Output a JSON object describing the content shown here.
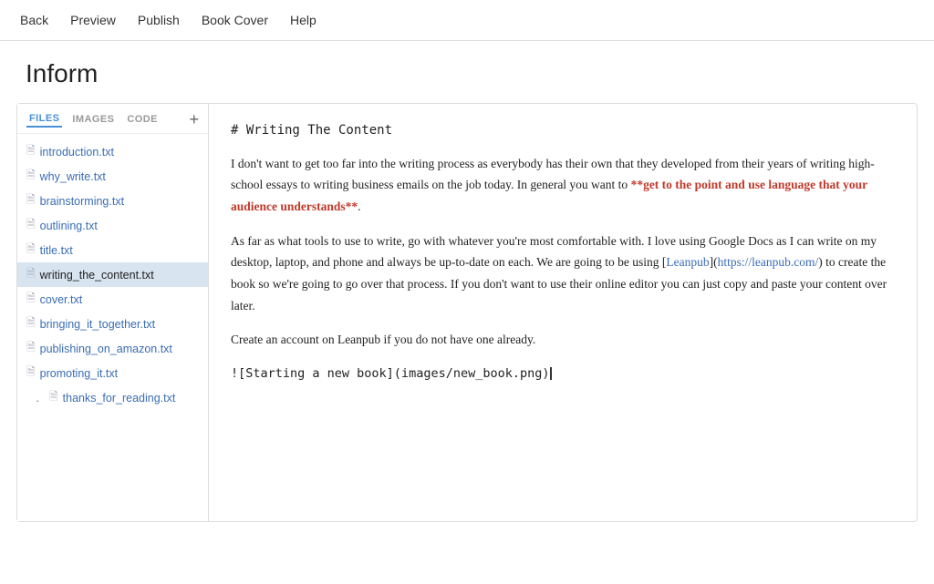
{
  "app_title": "Inform",
  "nav": {
    "items": [
      {
        "label": "Back",
        "key": "back"
      },
      {
        "label": "Preview",
        "key": "preview"
      },
      {
        "label": "Publish",
        "key": "publish"
      },
      {
        "label": "Book Cover",
        "key": "book-cover"
      },
      {
        "label": "Help",
        "key": "help"
      }
    ]
  },
  "sidebar": {
    "tabs": [
      {
        "label": "FILES",
        "active": true
      },
      {
        "label": "IMAGES",
        "active": false
      },
      {
        "label": "CODE",
        "active": false
      }
    ],
    "add_button": "+",
    "files": [
      {
        "name": "introduction.txt",
        "active": false
      },
      {
        "name": "why_write.txt",
        "active": false
      },
      {
        "name": "brainstorming.txt",
        "active": false
      },
      {
        "name": "outlining.txt",
        "active": false
      },
      {
        "name": "title.txt",
        "active": false
      },
      {
        "name": "writing_the_content.txt",
        "active": true
      },
      {
        "name": "cover.txt",
        "active": false
      },
      {
        "name": "bringing_it_together.txt",
        "active": false
      },
      {
        "name": "publishing_on_amazon.txt",
        "active": false
      },
      {
        "name": "promoting_it.txt",
        "active": false
      },
      {
        "name": "thanks_for_reading.txt",
        "active": false,
        "indent": true
      }
    ]
  },
  "editor": {
    "heading": "# Writing The Content",
    "paragraphs": [
      {
        "type": "mixed",
        "before": "I don't want to get too far into the writing process as everybody has their own that they developed from their years of writing high-school essays to writing business emails on the job today. In general you want to ",
        "bold_red": "**get to the point and use language that your audience understands**",
        "after": "."
      },
      {
        "type": "mixed",
        "before": "As far as what tools to use to write, go with whatever you're most comfortable with. I love using Google Docs as I can write on my desktop, laptop, and phone and always be up-to-date on each. We are going to be using [",
        "link_text": "Leanpub",
        "link_url": "https://leanpub.com/",
        "after": "](https://leanpub.com/) to create the book so we're going to go over that process. If you don't want to use their online editor you can just copy and paste your content over later."
      },
      {
        "type": "plain",
        "text": "Create an account on Leanpub if you do not have one already."
      },
      {
        "type": "cursor_line",
        "text": "![Starting a new book](images/new_book.png)"
      }
    ]
  }
}
